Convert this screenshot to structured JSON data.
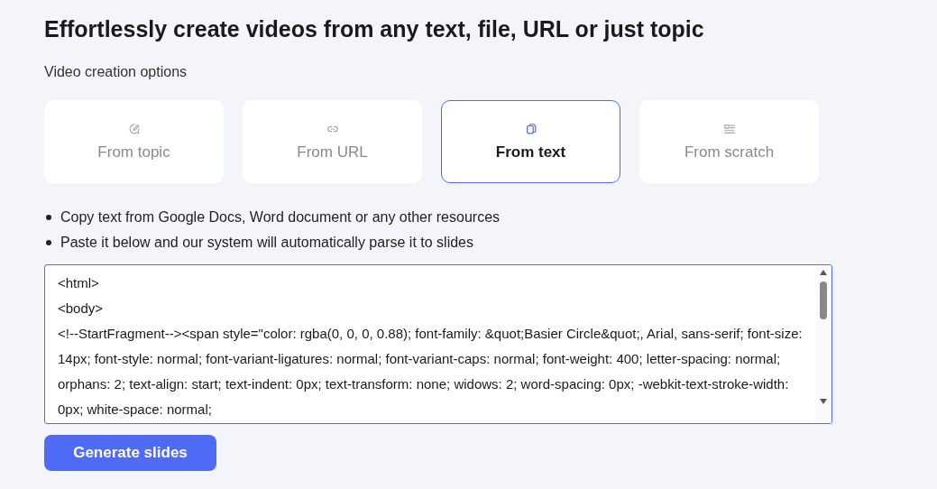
{
  "heading": "Effortlessly create videos from any text, file, URL or just topic",
  "options_label": "Video creation options",
  "options": [
    {
      "label": "From topic",
      "kind": "topic",
      "selected": false
    },
    {
      "label": "From URL",
      "kind": "url",
      "selected": false
    },
    {
      "label": "From text",
      "kind": "text",
      "selected": true
    },
    {
      "label": "From scratch",
      "kind": "scratch",
      "selected": false
    }
  ],
  "instructions": [
    "Copy text from Google Docs, Word document or any other resources",
    "Paste it below and our system will automatically parse it to slides"
  ],
  "text_input": {
    "value": "<html>\n<body>\n<!--StartFragment--><span style=\"color: rgba(0, 0, 0, 0.88); font-family: &quot;Basier Circle&quot;, Arial, sans-serif; font-size: 14px; font-style: normal; font-variant-ligatures: normal; font-variant-caps: normal; font-weight: 400; letter-spacing: normal; orphans: 2; text-align: start; text-indent: 0px; text-transform: none; widows: 2; word-spacing: 0px; -webkit-text-stroke-width: 0px; white-space: normal;"
  },
  "generate_button": "Generate slides"
}
